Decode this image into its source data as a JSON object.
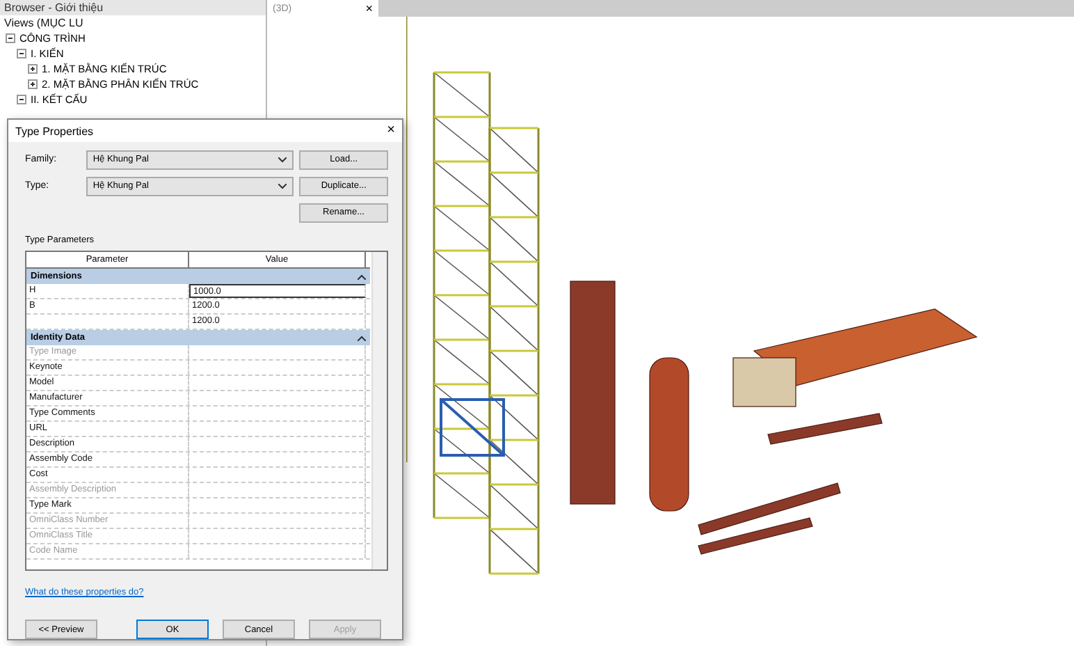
{
  "browser": {
    "title": "Browser - Giới thiệu",
    "views_label": "Views (MỤC LU",
    "tree": [
      {
        "label": "CÔNG TRÌNH",
        "expanded": true,
        "children": [
          {
            "label": "I. KIẾN",
            "expanded": true,
            "children": [
              {
                "label": "1. MẶT BẰNG KIẾN TRÚC",
                "expanded": false
              },
              {
                "label": "2. MẶT BẰNG PHÂN KIẾN TRÚC",
                "expanded": false
              }
            ]
          },
          {
            "label": "II. KẾT CẤU",
            "expanded": true
          }
        ]
      }
    ]
  },
  "view_tab": {
    "title": "(3D)",
    "close": "×"
  },
  "dialog": {
    "title": "Type Properties",
    "close": "×",
    "family_label": "Family:",
    "family_value": "Hệ Khung Pal",
    "type_label": "Type:",
    "type_value": "Hệ Khung Pal",
    "buttons": [
      "Load...",
      "Duplicate...",
      "Rename..."
    ],
    "section_label": "Type Parameters",
    "columns": [
      "Parameter",
      "Value"
    ],
    "groups": [
      {
        "title": "Dimensions",
        "rows": [
          {
            "name": "H",
            "value": "1000.0",
            "disabled": false,
            "selected": true
          },
          {
            "name": "B",
            "value": "1200.0",
            "disabled": false,
            "selected": false
          },
          {
            "value": "1200.0",
            "disabled": false,
            "selected": false
          }
        ]
      },
      {
        "title": "Identity Data",
        "rows": [
          {
            "name": "Type Image",
            "disabled": true,
            "selected": false
          },
          {
            "name": "Keynote",
            "disabled": false,
            "selected": false
          },
          {
            "name": "Model",
            "disabled": false,
            "selected": false
          },
          {
            "name": "Manufacturer",
            "disabled": false,
            "selected": false
          },
          {
            "name": "Type Comments",
            "disabled": false,
            "selected": false
          },
          {
            "name": "URL",
            "disabled": false,
            "selected": false
          },
          {
            "name": "Description",
            "disabled": false,
            "selected": false
          },
          {
            "name": "Assembly Code",
            "disabled": false,
            "selected": false
          },
          {
            "name": "Cost",
            "disabled": false,
            "selected": false
          },
          {
            "name": "Assembly Description",
            "disabled": true,
            "selected": false
          },
          {
            "name": "Type Mark",
            "disabled": false,
            "selected": false
          },
          {
            "name": "OmniClass Number",
            "disabled": true,
            "selected": false
          },
          {
            "name": "OmniClass Title",
            "disabled": true,
            "selected": false
          },
          {
            "name": "Code Name",
            "disabled": true,
            "selected": false
          }
        ]
      }
    ],
    "help_link": "What do these properties do?",
    "footer_buttons": [
      {
        "label": "<< Preview",
        "disabled": false,
        "default": false
      },
      {
        "label": "OK",
        "disabled": false,
        "default": true
      },
      {
        "label": "Cancel",
        "disabled": false,
        "default": false
      },
      {
        "label": "Apply",
        "disabled": true,
        "default": false
      }
    ]
  }
}
